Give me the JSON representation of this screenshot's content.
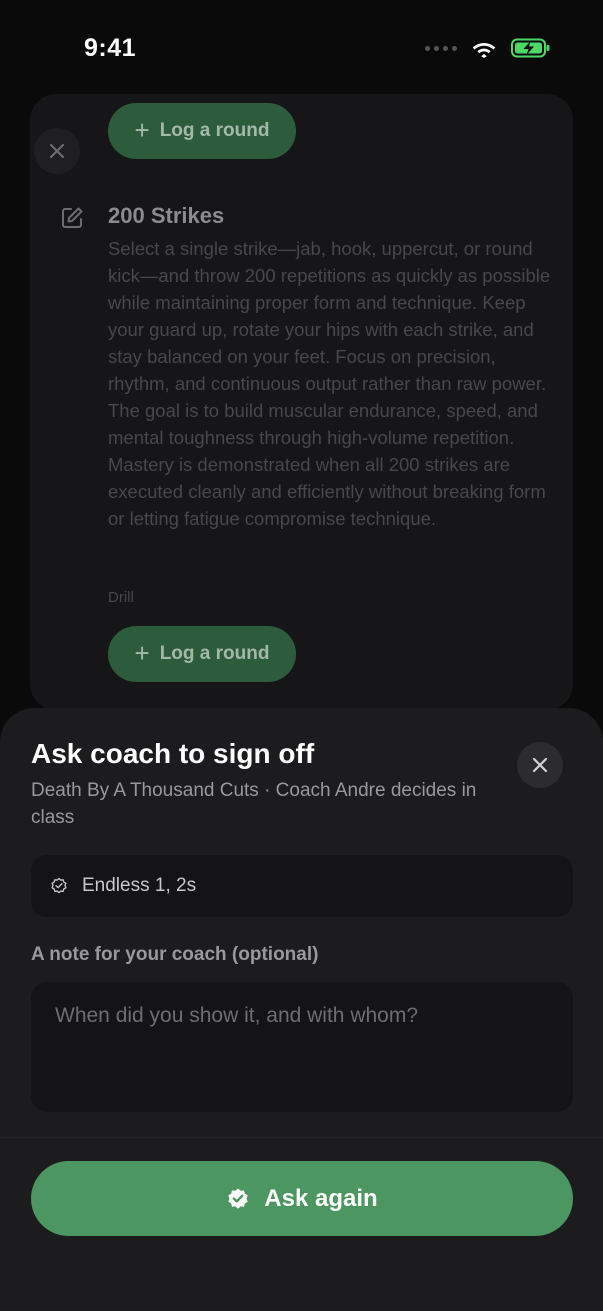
{
  "status_bar": {
    "time": "9:41"
  },
  "background": {
    "log_round_label": "Log a round",
    "drill": {
      "title": "200 Strikes",
      "description": "Select a single strike—jab, hook, uppercut, or round kick—and throw 200 repetitions as quickly as possible while maintaining proper form and technique. Keep your guard up, rotate your hips with each strike, and stay balanced on your feet. Focus on precision, rhythm, and continuous output rather than raw power. The goal is to build muscular endurance, speed, and mental toughness through high-volume repetition. Mastery is demonstrated when all 200 strikes are executed cleanly and efficiently without breaking form or letting fatigue compromise technique.",
      "type": "Drill"
    }
  },
  "sheet": {
    "title": "Ask coach to sign off",
    "subtitle": "Death By A Thousand Cuts · Coach Andre decides in class",
    "skill_label": "Endless 1, 2s",
    "note_label": "A note for your coach (optional)",
    "note_placeholder": "When did you show it, and with whom?",
    "note_value": "",
    "submit_label": "Ask again"
  },
  "colors": {
    "accent": "#4b9661",
    "sheet_bg": "#1c1c1e",
    "battery": "#4cd964"
  },
  "icons": {
    "close": "close-icon",
    "edit": "edit-icon",
    "plus": "plus-icon",
    "verified": "verified-badge-icon"
  }
}
